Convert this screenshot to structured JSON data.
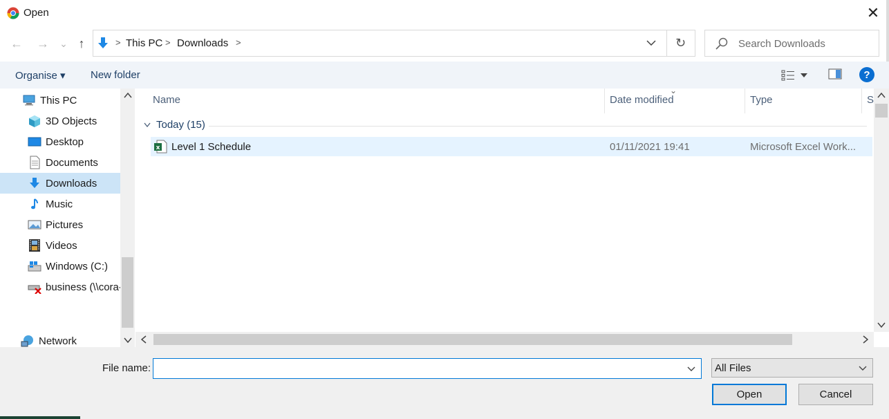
{
  "window": {
    "title": "Open",
    "close_glyph": "✕"
  },
  "nav": {
    "back_glyph": "←",
    "forward_glyph": "→",
    "recent_glyph": "⌄",
    "up_glyph": "↑",
    "address": {
      "crumbs": [
        "This PC",
        "Downloads"
      ],
      "icon": "download-arrow-icon"
    },
    "refresh_glyph": "↻"
  },
  "search": {
    "placeholder": "Search Downloads",
    "value": ""
  },
  "toolbar": {
    "organise_label": "Organise ▾",
    "new_folder_label": "New folder",
    "help_label": "?"
  },
  "sidebar": {
    "items": [
      {
        "label": "This PC",
        "icon": "computer-icon"
      },
      {
        "label": "3D Objects",
        "icon": "cube-icon"
      },
      {
        "label": "Desktop",
        "icon": "desktop-icon"
      },
      {
        "label": "Documents",
        "icon": "document-icon"
      },
      {
        "label": "Downloads",
        "icon": "download-icon",
        "selected": true
      },
      {
        "label": "Music",
        "icon": "music-note-icon"
      },
      {
        "label": "Pictures",
        "icon": "picture-icon"
      },
      {
        "label": "Videos",
        "icon": "film-icon"
      },
      {
        "label": "Windows (C:)",
        "icon": "drive-icon"
      },
      {
        "label": "business (\\\\cora-",
        "icon": "network-drive-disconnected-icon"
      },
      {
        "label": "Network",
        "icon": "network-icon"
      }
    ]
  },
  "filelist": {
    "columns": [
      "Name",
      "Date modified",
      "Type",
      "S"
    ],
    "sort_glyph": "⌄",
    "group": {
      "label": "Today (15)"
    },
    "rows": [
      {
        "name": "Level 1 Schedule",
        "date": "01/11/2021 19:41",
        "type": "Microsoft Excel Work...",
        "icon": "excel-file-icon"
      }
    ]
  },
  "bottom": {
    "filename_label": "File name:",
    "filename_value": "",
    "filter_value": "All Files",
    "open_label": "Open",
    "cancel_label": "Cancel"
  },
  "colors": {
    "accent": "#0078d7",
    "selection": "#cce4f7",
    "link": "#1e3f66",
    "excel_green": "#1d6f42"
  }
}
